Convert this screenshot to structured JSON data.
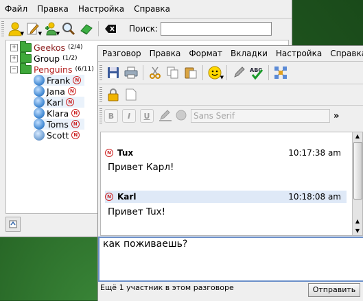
{
  "contact_list": {
    "menu": [
      "Файл",
      "Правка",
      "Настройка",
      "Справка"
    ],
    "toolbar_icons": [
      "status-avatar-icon",
      "edit-icon",
      "add-contact-icon",
      "search-icon",
      "bookmarks-icon",
      "clear-icon"
    ],
    "search_label": "Поиск:",
    "search_value": "",
    "groups": [
      {
        "name": "Geekos",
        "count": "(2/4)",
        "expanded": false
      },
      {
        "name": "Group",
        "count": "(1/2)",
        "expanded": false
      },
      {
        "name": "Penguins",
        "count": "(6/11)",
        "expanded": true
      }
    ],
    "contacts": [
      "Frank",
      "Jana",
      "Karl",
      "Klara",
      "Toms",
      "Scott"
    ],
    "colors": {
      "group_name_geekos": "#8b1a1a",
      "group_name_penguins": "#b21c1c",
      "folder": "#3fa83a",
      "zebra": "#eaf2fb"
    }
  },
  "chat": {
    "menu": [
      "Разговор",
      "Правка",
      "Формат",
      "Вкладки",
      "Настройка",
      "Справка"
    ],
    "toolbar_icons": [
      "save-icon",
      "print-icon",
      "cut-icon",
      "copy-icon",
      "paste-icon",
      "emoticon-icon",
      "pen-icon",
      "spellcheck-icon",
      "network-icon"
    ],
    "font_field": "Sans Serif",
    "format_buttons": [
      "B",
      "I",
      "U"
    ],
    "messages": [
      {
        "sender": "Tux",
        "time": "10:17:38 am",
        "text": "Привет Карл!"
      },
      {
        "sender": "Karl",
        "time": "10:18:08 am",
        "text": "Привет Tux!"
      }
    ],
    "input_text": "как поживаешь?",
    "status_text": "Ещё 1 участник в этом разговоре",
    "send_label": "Отправить",
    "colors": {
      "input_border": "#6a8fc9",
      "alt_header": "#dfe9f7"
    }
  }
}
